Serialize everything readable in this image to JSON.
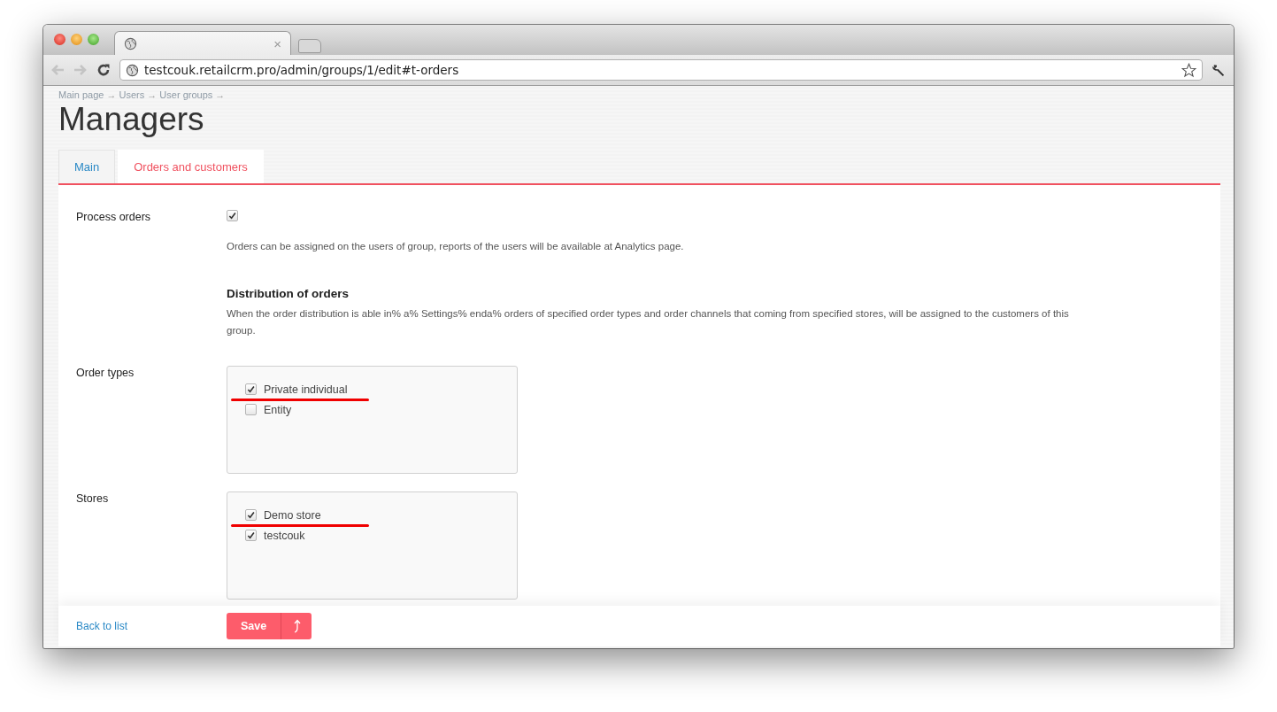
{
  "browser": {
    "tab_close": "×",
    "url": "testcouk.retailcrm.pro/admin/groups/1/edit#t-orders"
  },
  "breadcrumbs": [
    {
      "label": "Main page",
      "separator": "→"
    },
    {
      "label": "Users",
      "separator": "→"
    },
    {
      "label": "User groups",
      "separator": "→"
    }
  ],
  "title": "Managers",
  "tabs": [
    {
      "label": "Main",
      "selected": false
    },
    {
      "label": "Orders and customers",
      "selected": true
    }
  ],
  "rows": [
    {
      "kind": "checkbox",
      "label": "Process orders",
      "checked": true,
      "hint": "Orders can be assigned on the users of group, reports of the users will be available at Analytics page."
    },
    {
      "kind": "section",
      "title": "Distribution of orders",
      "text": "When the order distribution is able in% a% Settings% enda% orders of specified order types and order channels that coming from specified stores, will be assigned to the customers of this group."
    },
    {
      "kind": "checklist",
      "label": "Order types",
      "options": [
        {
          "label": "Private individual",
          "checked": true,
          "underlined": true
        },
        {
          "label": "Entity",
          "checked": false,
          "underlined": false
        }
      ]
    },
    {
      "kind": "checklist",
      "label": "Stores",
      "options": [
        {
          "label": "Demo store",
          "checked": true,
          "underlined": true
        },
        {
          "label": "testcouk",
          "checked": true,
          "underlined": false
        }
      ]
    }
  ],
  "footer": {
    "back_link": "Back to list",
    "save_button": "Save"
  }
}
